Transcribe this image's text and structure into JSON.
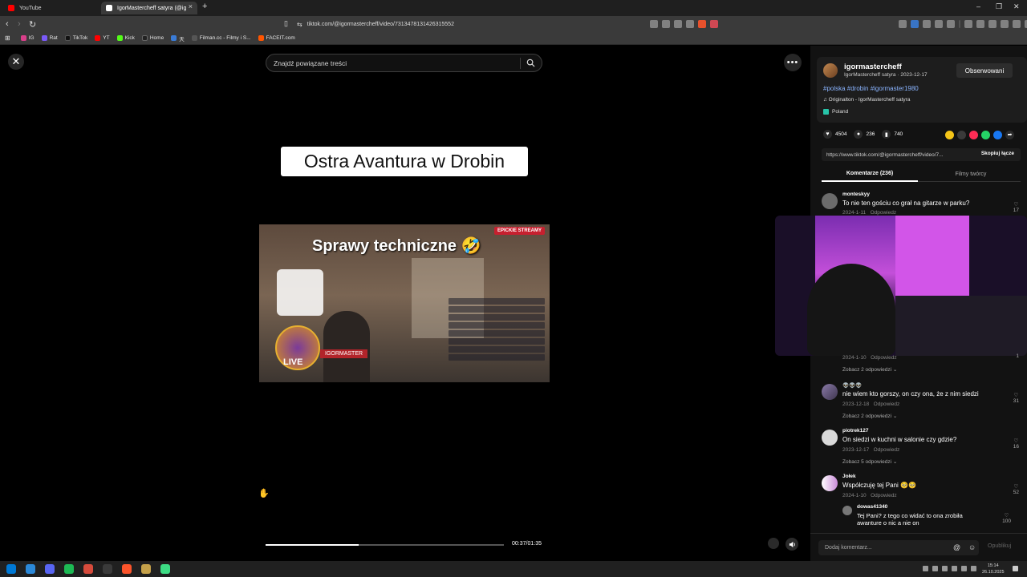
{
  "browser": {
    "tabs": [
      {
        "label": "YouTube",
        "favicon_color": "#ff0000",
        "active": false
      },
      {
        "label": "IgorMastercheff satyra (@ig",
        "favicon_color": "#ffffff",
        "active": true
      }
    ],
    "url": "tiktok.com/@igormastercheff/video/7313478131426315552",
    "bookmarks": [
      {
        "label": "IG",
        "color": "#d93f8a"
      },
      {
        "label": "Rat",
        "color": "#7a5af8"
      },
      {
        "label": "TikTok",
        "color": "#111111"
      },
      {
        "label": "YT",
        "color": "#ff0000"
      },
      {
        "label": "Kick",
        "color": "#53fc18"
      },
      {
        "label": "Home",
        "color": "#222222"
      },
      {
        "label": "天",
        "color": "#3a7bd5"
      },
      {
        "label": "Filman.cc - Filmy i S...",
        "color": "#3a3a3a"
      },
      {
        "label": "FACEIT.com",
        "color": "#ff5500"
      }
    ]
  },
  "video": {
    "search_placeholder": "Znajdź powiązane treści",
    "title_card": "Ostra Avantura w Drobin",
    "clip_caption": "Sprawy techniczne 🤣",
    "clip_badge": "EPICKIE STREAMY",
    "clip_live": "LIVE",
    "clip_nameplate": "IGORMASTER",
    "time": "00:37/01:35",
    "progress": 0.39
  },
  "creator": {
    "name": "igormastercheff",
    "subtitle": "IgorMastercheff satyra · 2023-12-17",
    "follow_label": "Obserwowani",
    "tags": "#polska #drobin #igormaster1980",
    "sound": "♫  Originalton - IgorMastercheff satyra",
    "location": "Poland"
  },
  "stats": {
    "likes": "4504",
    "comments": "236",
    "saves": "740"
  },
  "share_colors": [
    "#f5c518",
    "#3a3a3a",
    "#fe2c55",
    "#25d366",
    "#1877f2",
    "#2a2a2a"
  ],
  "copy_link": {
    "url": "https://www.tiktok.com/@igormastercheff/video/7...",
    "button": "Skopiuj łącze"
  },
  "panel_tabs": {
    "comments": "Komentarze (236)",
    "creator_videos": "Filmy twórcy"
  },
  "comments": [
    {
      "user": "monteskyy",
      "text": "To nie ten gościu co grał na gitarze w parku?",
      "date": "2024-1-11",
      "reply": "Odpowiedz",
      "likes": "17"
    },
    {
      "user": "",
      "text": "",
      "date": "2024-1-10",
      "reply": "Odpowiedz",
      "likes": "1",
      "view_replies": "Zobacz 2 odpowiedzi ⌄"
    },
    {
      "user": "👽👽👽",
      "text": "nie wiem kto gorszy, on czy ona, że z nim siedzi",
      "date": "2023-12-18",
      "reply": "Odpowiedz",
      "likes": "31",
      "view_replies": "Zobacz 2 odpowiedzi ⌄"
    },
    {
      "user": "piotrek127",
      "text": "On siedzi w kuchni w salonie czy gdzie?",
      "date": "2023-12-17",
      "reply": "Odpowiedz",
      "likes": "16",
      "view_replies": "Zobacz 5 odpowiedzi ⌄"
    },
    {
      "user": "Jołek",
      "text": "Współczuję tej Pani 🥺🥺",
      "date": "2024-1-10",
      "reply": "Odpowiedz",
      "likes": "52"
    },
    {
      "user": "dowas41340",
      "text": "Tej Pani? z tego co widać to ona zrobiła awanture o nic a nie on",
      "date": "",
      "reply": "",
      "likes": "100"
    }
  ],
  "comment_bar": {
    "placeholder": "Dodaj komentarz...",
    "post": "Opublikuj"
  },
  "taskbar": {
    "time": "15:14",
    "date": "26.10.2025",
    "apps": [
      "#0078d4",
      "#2b88d8",
      "#5865f2",
      "#1db954",
      "#d64b3c",
      "#3a3a3a",
      "#fb542b",
      "#c5a14a",
      "#3ddc84"
    ]
  }
}
